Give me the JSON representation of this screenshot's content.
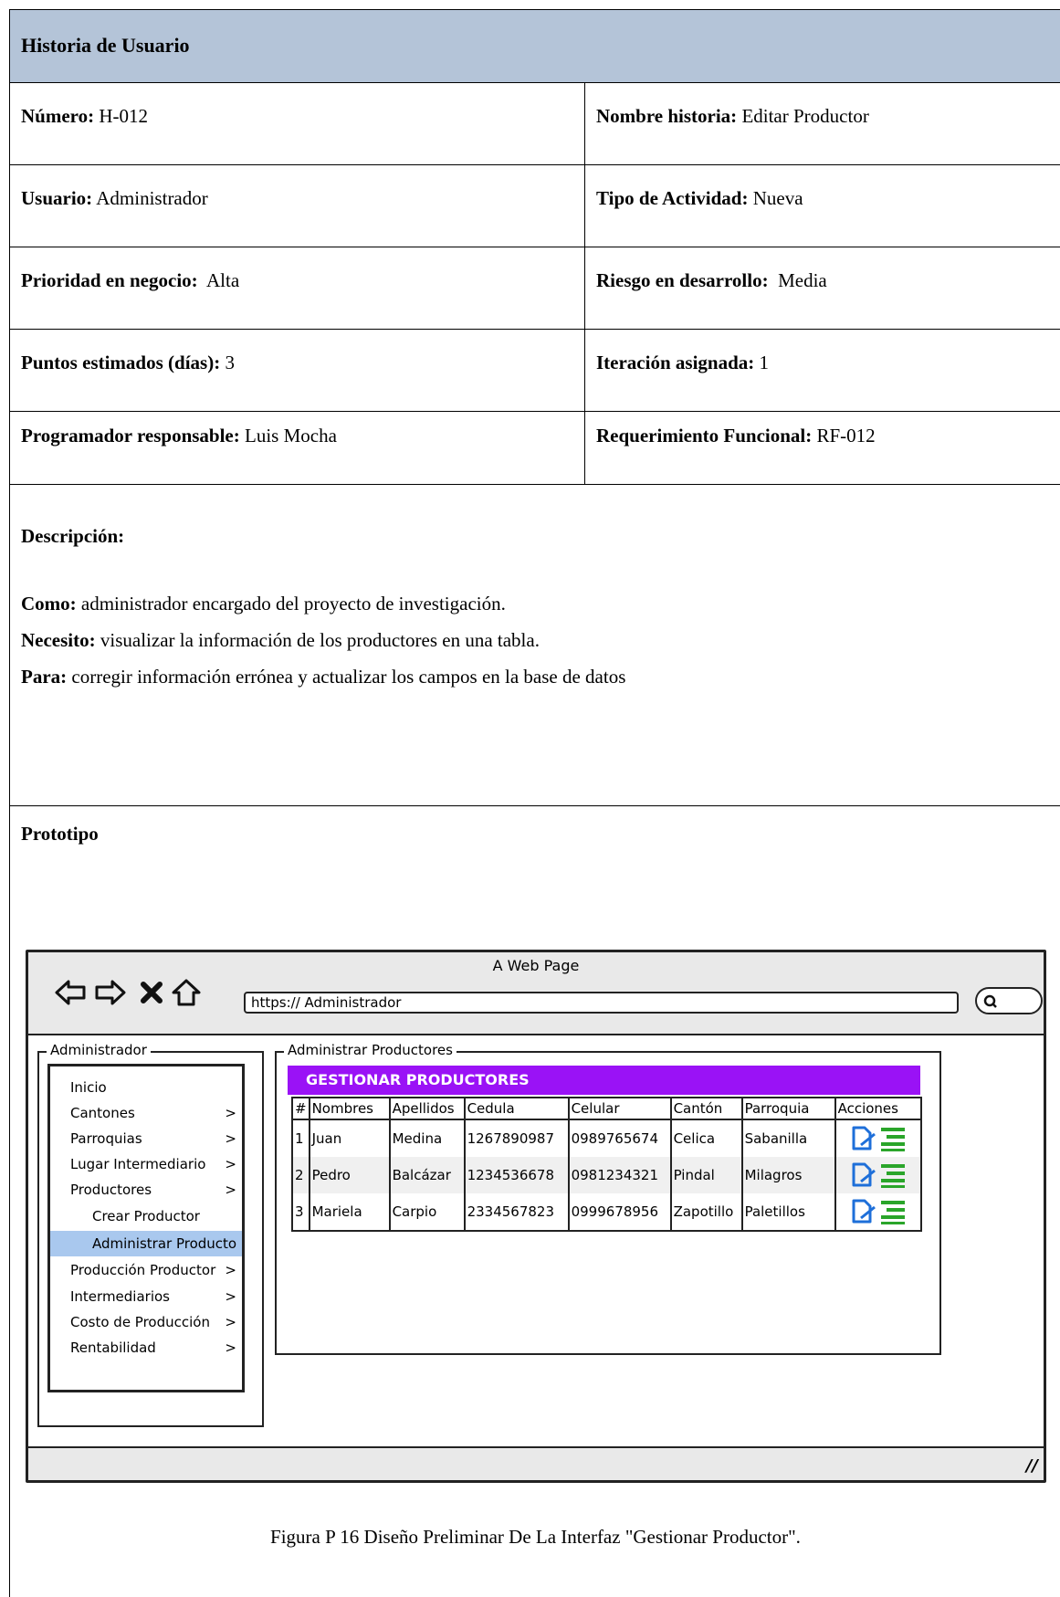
{
  "doc": {
    "title": "Historia de Usuario",
    "fields": [
      {
        "left_label": "Número:",
        "left_value": " H-012",
        "right_label": "Nombre historia:",
        "right_value": " Editar Productor"
      },
      {
        "left_label": "Usuario:",
        "left_value": " Administrador",
        "right_label": "Tipo de Actividad:",
        "right_value": " Nueva"
      },
      {
        "left_label": "Prioridad en negocio:",
        "left_value": "  Alta",
        "right_label": "Riesgo en desarrollo:",
        "right_value": "  Media"
      },
      {
        "left_label": "Puntos estimados (días):",
        "left_value": " 3",
        "right_label": "Iteración asignada:",
        "right_value": " 1"
      },
      {
        "left_label": "Programador responsable:",
        "left_value": " Luis Mocha",
        "right_label": "Requerimiento Funcional:",
        "right_value": " RF-012"
      }
    ],
    "description": {
      "heading": "Descripción:",
      "como_label": "Como:",
      "como_value": " administrador encargado del proyecto de investigación.",
      "necesito_label": "Necesito:",
      "necesito_value": " visualizar la información de los productores en una tabla.",
      "para_label": "Para:",
      "para_value": " corregir información errónea y actualizar los campos en la base de datos"
    },
    "prototype_label": "Prototipo",
    "caption": "Figura P 16 Diseño Preliminar De La Interfaz \"Gestionar Productor\"."
  },
  "mockup": {
    "window_title": "A Web Page",
    "url": "https:// Administrador",
    "sidebar_legend": "Administrador",
    "main_legend": "Administrar Productores",
    "banner": "GESTIONAR PRODUCTORES",
    "menu": [
      {
        "label": "Inicio",
        "chevron": ""
      },
      {
        "label": "Cantones",
        "chevron": ">"
      },
      {
        "label": "Parroquias",
        "chevron": ">"
      },
      {
        "label": "Lugar Intermediario",
        "chevron": ">"
      },
      {
        "label": "Productores",
        "chevron": ">"
      },
      {
        "label": "Crear Productor",
        "chevron": ""
      },
      {
        "label": "Administrar Producto",
        "chevron": ""
      },
      {
        "label": "Producción Productor",
        "chevron": ">"
      },
      {
        "label": "Intermediarios",
        "chevron": ">"
      },
      {
        "label": "Costo de Producción",
        "chevron": ">"
      },
      {
        "label": "Rentabilidad",
        "chevron": ">"
      }
    ],
    "table": {
      "headers": [
        "#",
        "Nombres",
        "Apellidos",
        "Cedula",
        "Celular",
        "Cantón",
        "Parroquia",
        "Acciones"
      ],
      "rows": [
        [
          "1",
          "Juan",
          "Medina",
          "1267890987",
          "0989765674",
          "Celica",
          "Sabanilla"
        ],
        [
          "2",
          "Pedro",
          "Balcázar",
          "1234536678",
          "0981234321",
          "Pindal",
          "Milagros"
        ],
        [
          "3",
          "Mariela",
          "Carpio",
          "2334567823",
          "0999678956",
          "Zapotillo",
          "Paletillos"
        ]
      ]
    },
    "colors": {
      "banner": "#9a12f6",
      "active_menu": "#a9c8ee",
      "edit_icon": "#1e6fd9",
      "list_icon": "#2aa52a",
      "header_bar": "#b4c4d8"
    }
  }
}
